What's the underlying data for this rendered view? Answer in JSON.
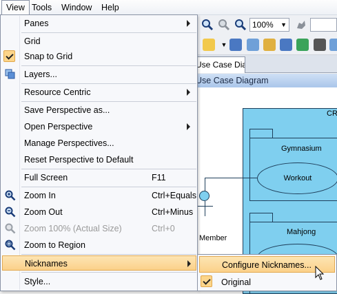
{
  "menubar": {
    "items": [
      {
        "label": "View"
      },
      {
        "label": "Tools"
      },
      {
        "label": "Window"
      },
      {
        "label": "Help"
      }
    ]
  },
  "toolbar": {
    "zoom_value": "100%"
  },
  "tab": {
    "label": "Use Case Diagram"
  },
  "diagram": {
    "header": "Use Case Diagram",
    "system_label": "CR",
    "package1": "Gymnasium",
    "usecase1": "Workout",
    "package2": "Mahjong",
    "actor": "Member"
  },
  "view_menu": {
    "items": [
      {
        "label": "Panes",
        "submenu": true
      },
      {
        "label": "Grid"
      },
      {
        "label": "Snap to Grid",
        "checked": true
      },
      {
        "label": "Layers...",
        "icon": "layers-icon"
      },
      {
        "label": "Resource Centric",
        "submenu": true
      },
      {
        "label": "Save Perspective as..."
      },
      {
        "label": "Open Perspective",
        "submenu": true
      },
      {
        "label": "Manage Perspectives..."
      },
      {
        "label": "Reset Perspective to Default"
      },
      {
        "label": "Full Screen",
        "accelerator": "F11"
      },
      {
        "label": "Zoom In",
        "accelerator": "Ctrl+Equals",
        "icon": "zoom-in-icon"
      },
      {
        "label": "Zoom Out",
        "accelerator": "Ctrl+Minus",
        "icon": "zoom-out-icon"
      },
      {
        "label": "Zoom 100% (Actual Size)",
        "accelerator": "Ctrl+0",
        "icon": "zoom-actual-icon",
        "disabled": true
      },
      {
        "label": "Zoom to Region",
        "icon": "zoom-region-icon"
      },
      {
        "label": "Nicknames",
        "submenu": true,
        "highlighted": true
      },
      {
        "label": "Style..."
      }
    ]
  },
  "nicknames_submenu": {
    "items": [
      {
        "label": "Configure Nicknames...",
        "highlighted": true
      },
      {
        "label": "Original",
        "checked": true
      }
    ]
  },
  "colors": {
    "highlight": "#fbd18a",
    "diagram_fill": "#7fcfef",
    "diagram_stroke": "#1e3e5a"
  }
}
